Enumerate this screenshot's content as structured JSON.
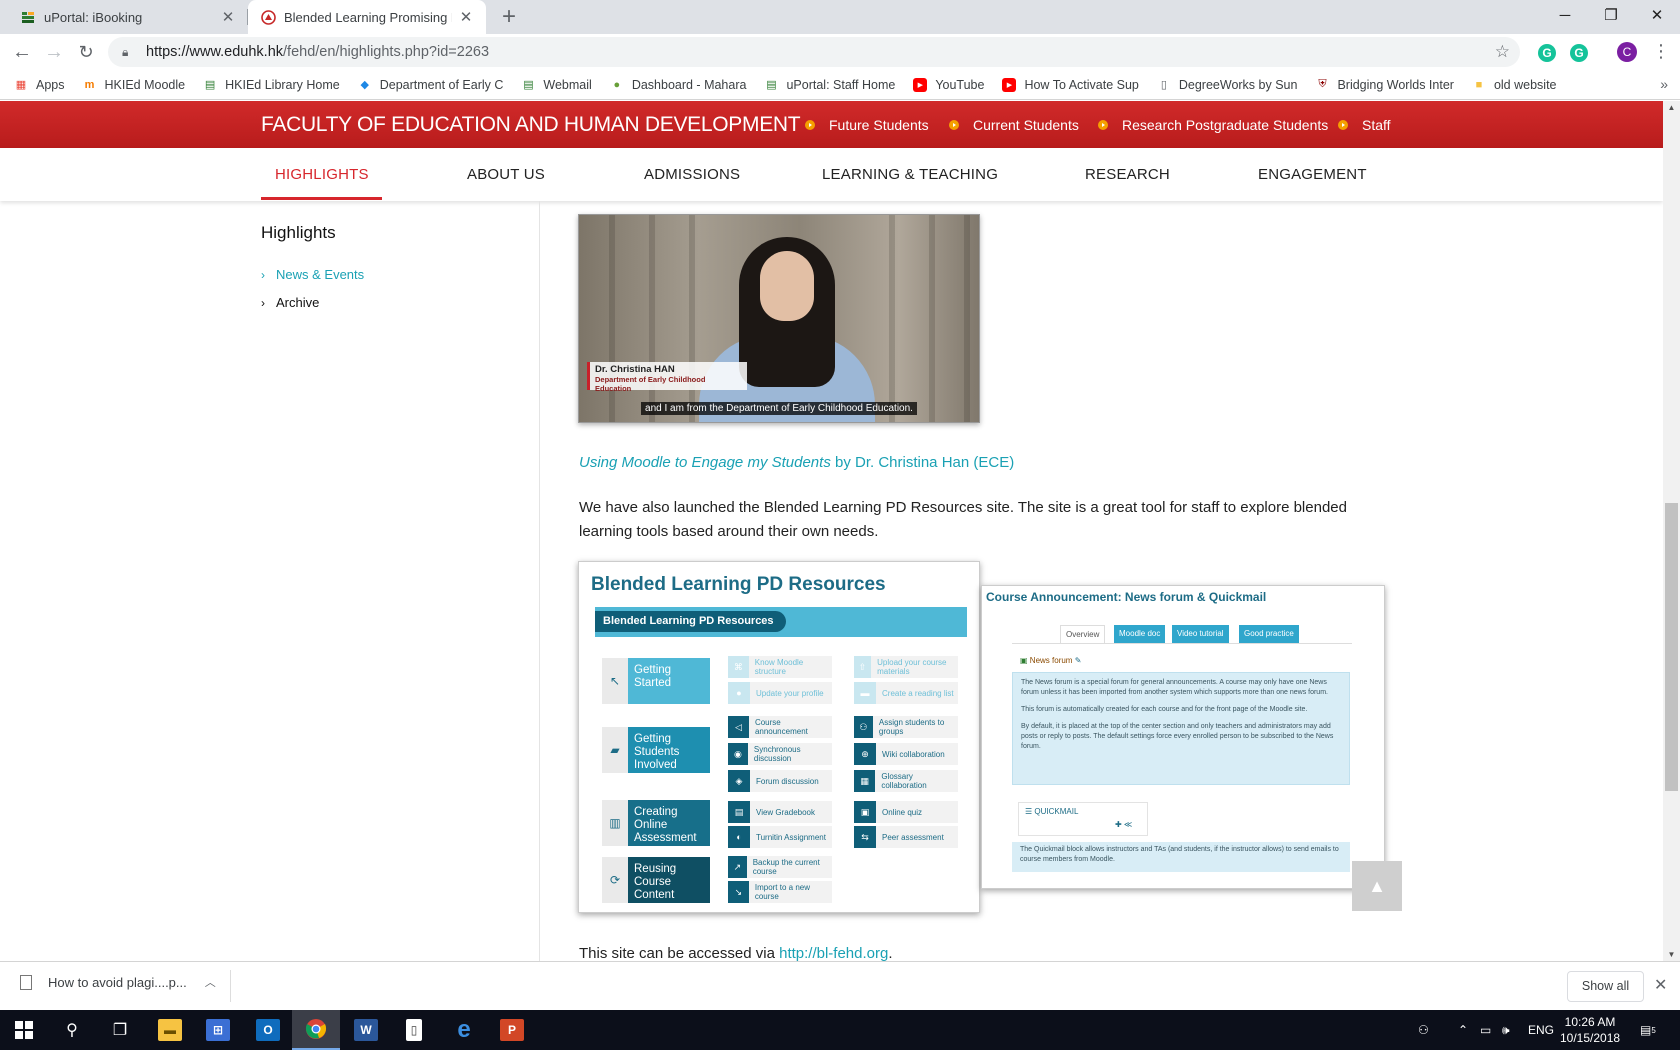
{
  "browser": {
    "tabs": [
      {
        "title": "uPortal: iBooking"
      },
      {
        "title": "Blended Learning Promising Prac"
      }
    ],
    "url_host": "https://www.eduhk.hk",
    "url_path": "/fehd/en/highlights.php?id=2263",
    "profile_initial": "C",
    "bookmarks": [
      {
        "label": "Apps"
      },
      {
        "label": "HKIEd Moodle"
      },
      {
        "label": "HKIEd Library Home"
      },
      {
        "label": "Department of Early C"
      },
      {
        "label": "Webmail"
      },
      {
        "label": "Dashboard - Mahara"
      },
      {
        "label": "uPortal: Staff Home"
      },
      {
        "label": "YouTube"
      },
      {
        "label": "How To Activate Sup"
      },
      {
        "label": "DegreeWorks by Sun"
      },
      {
        "label": "Bridging Worlds Inter"
      },
      {
        "label": "old website"
      }
    ]
  },
  "site": {
    "faculty_title": "FACULTY OF EDUCATION AND HUMAN DEVELOPMENT",
    "top_links": [
      "Future Students",
      "Current Students",
      "Research Postgraduate Students",
      "Staff"
    ],
    "main_nav": [
      "HIGHLIGHTS",
      "ABOUT US",
      "ADMISSIONS",
      "LEARNING & TEACHING",
      "RESEARCH",
      "ENGAGEMENT"
    ],
    "brand_red": "#d7262c",
    "link_teal": "#1aa1b4"
  },
  "sidebar": {
    "title": "Highlights",
    "links": [
      "News & Events",
      "Archive"
    ]
  },
  "video": {
    "lower_third_name": "Dr. Christina HAN",
    "lower_third_dept": "Department of Early Childhood Education",
    "subtitle": "and I am from the Department of Early Childhood Education."
  },
  "content": {
    "caption_title": "Using Moodle to Engage my Students",
    "caption_rest": " by Dr. Christina Han (ECE)",
    "paragraph": "We have also launched the Blended Learning PD Resources site. The site is a great tool for staff to explore blended learning tools based around their own needs.",
    "access_text": "This site can be accessed via ",
    "access_link": "http://bl-fehd.org",
    "access_end": "."
  },
  "pd_image": {
    "title": "Blended Learning PD Resources",
    "banner": "Blended Learning PD Resources",
    "categories": [
      "Getting Started",
      "Getting Students Involved",
      "Creating Online Assessment",
      "Reusing Course Content"
    ],
    "col1": [
      "Know Moodle structure",
      "Update your profile",
      "Course announcement",
      "Synchronous discussion",
      "Forum discussion",
      "View Gradebook",
      "Turnitin Assignment",
      "Backup the current course",
      "Import to a new course"
    ],
    "col2": [
      "Upload your course materials",
      "Create a reading list",
      "Assign students to groups",
      "Wiki collaboration",
      "Glossary collaboration",
      "Online quiz",
      "Peer assessment"
    ]
  },
  "ann_image": {
    "title": "Course Announcement: News forum & Quickmail",
    "tabs": [
      "Overview",
      "Moodle doc",
      "Video tutorial",
      "Good practice"
    ],
    "forum_label": "News forum",
    "para1": "The News forum is a special forum for general announcements. A course may only have one News forum unless it has been imported from another system which supports more than one news forum.",
    "para2": "This forum is automatically created for each course and for the front page of the Moodle site.",
    "para3": "By default, it is placed at the top of the center section and only teachers and administrators may add posts or reply to posts. The default settings force every enrolled person to be subscribed to the News forum.",
    "quickmail": "QUICKMAIL",
    "para4": "The Quickmail block allows instructors and TAs (and students, if the instructor allows) to send emails to course members from Moodle."
  },
  "downloads": {
    "file": "How to avoid plagi....p...",
    "show_all": "Show all"
  },
  "taskbar": {
    "lang": "ENG",
    "time": "10:26 AM",
    "date": "10/15/2018",
    "notifications": "5"
  }
}
